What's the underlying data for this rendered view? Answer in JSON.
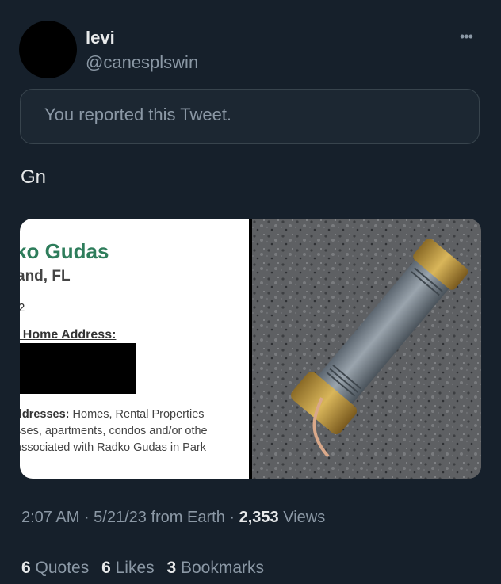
{
  "author": {
    "name": "levi",
    "handle": "@canesplswin",
    "more_icon": "more-horizontal-icon"
  },
  "report_notice": "You reported this Tweet.",
  "tweet_text": "Gn",
  "media": {
    "left_image": {
      "title": "ko Gudas",
      "subtitle": "and, FL",
      "number": "2",
      "home_label": "t Home Address:",
      "addresses_label": "ddresses:",
      "addresses_line1": " Homes, Rental Properties",
      "addresses_line2": "sses, apartments, condos and/or othe",
      "addresses_line3": "associated with Radko Gudas in Park"
    },
    "right_image": {
      "description_icon": "pipe-bomb-photo"
    }
  },
  "meta": {
    "time": "2:07 AM",
    "sep1": " · ",
    "date": "5/21/23",
    "source": " from Earth",
    "sep2": " · ",
    "views_count": "2,353",
    "views_label": " Views"
  },
  "stats": {
    "quotes_count": "6",
    "quotes_label": " Quotes",
    "likes_count": "6",
    "likes_label": " Likes",
    "bookmarks_count": "3",
    "bookmarks_label": " Bookmarks"
  }
}
